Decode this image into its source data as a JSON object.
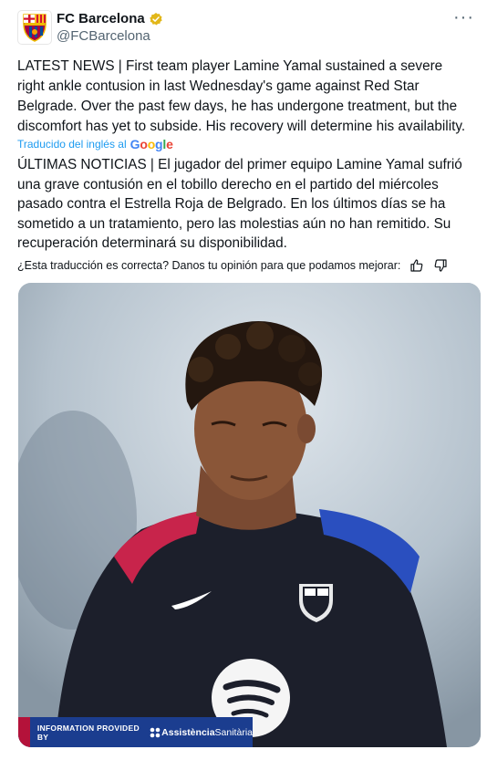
{
  "header": {
    "display_name": "FC Barcelona",
    "handle": "@FCBarcelona",
    "more": "···"
  },
  "tweet": {
    "text_en": "LATEST NEWS | First team player Lamine Yamal sustained a severe right ankle contusion in last Wednesday's game against Red Star Belgrade. Over the past few days, he has undergone treatment, but the discomfort has yet to subside. His recovery will determine his availability.",
    "translated_by": "Traducido del inglés al",
    "translator": "Google",
    "text_es": "ÚLTIMAS NOTICIAS | El jugador del primer equipo Lamine Yamal sufrió una grave contusión en el tobillo derecho en el partido del miércoles pasado contra el Estrella Roja de Belgrado. En los últimos días se ha sometido a un tratamiento, pero las molestias aún no han remitido. Su recuperación determinará su disponibilidad.",
    "feedback_question": "¿Esta traducción es correcta? Danos tu opinión para que podamos mejorar:"
  },
  "media": {
    "banner_text": "INFORMATION PROVIDED BY",
    "sponsor_part1": "Assistència",
    "sponsor_part2": "Sanitària"
  },
  "icons": {
    "verified": "verified-badge-icon",
    "thumbs_up": "thumbs-up-icon",
    "thumbs_down": "thumbs-down-icon"
  },
  "colors": {
    "link": "#1d9bf0",
    "verified_gold": "#e2b719",
    "banner_blue": "#1b3d8f",
    "banner_red": "#b4123a"
  }
}
